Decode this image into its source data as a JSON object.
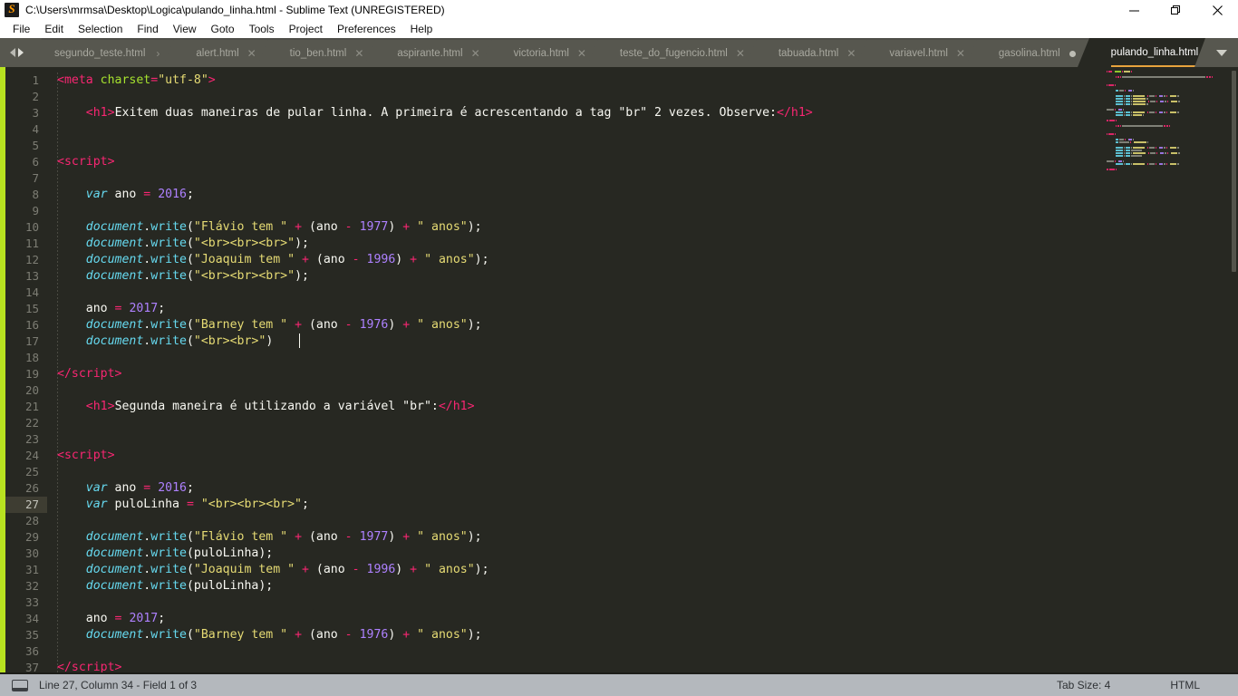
{
  "window": {
    "title": "C:\\Users\\mrmsa\\Desktop\\Logica\\pulando_linha.html - Sublime Text (UNREGISTERED)",
    "logo": "sublime-text-logo",
    "minimize": "—",
    "maximize": "❐",
    "close": "✕"
  },
  "menu": {
    "items": [
      {
        "label": "File"
      },
      {
        "label": "Edit"
      },
      {
        "label": "Selection"
      },
      {
        "label": "Find"
      },
      {
        "label": "View"
      },
      {
        "label": "Goto"
      },
      {
        "label": "Tools"
      },
      {
        "label": "Project"
      },
      {
        "label": "Preferences"
      },
      {
        "label": "Help"
      }
    ]
  },
  "tabs": {
    "overflow_icon": "chevron-down-icon",
    "items": [
      {
        "label": "segundo_teste.html",
        "state": "sep",
        "marker": "›",
        "active": false
      },
      {
        "label": "alert.html",
        "state": "close",
        "marker": "✕",
        "active": false
      },
      {
        "label": "tio_ben.html",
        "state": "close",
        "marker": "✕",
        "active": false
      },
      {
        "label": "aspirante.html",
        "state": "close",
        "marker": "✕",
        "active": false
      },
      {
        "label": "victoria.html",
        "state": "close",
        "marker": "✕",
        "active": false
      },
      {
        "label": "teste_do_fugencio.html",
        "state": "close",
        "marker": "✕",
        "active": false
      },
      {
        "label": "tabuada.html",
        "state": "close",
        "marker": "✕",
        "active": false
      },
      {
        "label": "variavel.html",
        "state": "close",
        "marker": "✕",
        "active": false
      },
      {
        "label": "gasolina.html",
        "state": "dirty",
        "marker": "●",
        "active": false
      },
      {
        "label": "pulando_linha.html",
        "state": "close",
        "marker": "✕",
        "active": true
      }
    ]
  },
  "editor": {
    "accent_color": "#e8a33d",
    "left_stripe_color": "#b8e220",
    "background": "#272822",
    "current_line": 27,
    "first_line": 1,
    "last_line": 37,
    "lines": [
      {
        "n": 1,
        "tokens": [
          {
            "t": "<",
            "c": "tg"
          },
          {
            "t": "meta",
            "c": "tg"
          },
          {
            "t": " ",
            "c": "pl"
          },
          {
            "t": "charset",
            "c": "at"
          },
          {
            "t": "=",
            "c": "tg"
          },
          {
            "t": "\"utf-8\"",
            "c": "st"
          },
          {
            "t": ">",
            "c": "tg"
          }
        ]
      },
      {
        "n": 2,
        "tokens": []
      },
      {
        "n": 3,
        "tokens": [
          {
            "t": "    ",
            "c": "pl"
          },
          {
            "t": "<",
            "c": "tg"
          },
          {
            "t": "h1",
            "c": "tg"
          },
          {
            "t": ">",
            "c": "tg"
          },
          {
            "t": "Exitem duas maneiras de pular linha. A primeira é acrescentando a tag \"br\" 2 vezes. Observe:",
            "c": "pl"
          },
          {
            "t": "</",
            "c": "tg"
          },
          {
            "t": "h1",
            "c": "tg"
          },
          {
            "t": ">",
            "c": "tg"
          }
        ]
      },
      {
        "n": 4,
        "tokens": []
      },
      {
        "n": 5,
        "tokens": []
      },
      {
        "n": 6,
        "tokens": [
          {
            "t": "<",
            "c": "tg"
          },
          {
            "t": "script",
            "c": "tg"
          },
          {
            "t": ">",
            "c": "tg"
          }
        ]
      },
      {
        "n": 7,
        "tokens": []
      },
      {
        "n": 8,
        "tokens": [
          {
            "t": "    ",
            "c": "pl"
          },
          {
            "t": "var",
            "c": "kw"
          },
          {
            "t": " ano ",
            "c": "pl"
          },
          {
            "t": "=",
            "c": "tg"
          },
          {
            "t": " ",
            "c": "pl"
          },
          {
            "t": "2016",
            "c": "nu"
          },
          {
            "t": ";",
            "c": "pn"
          }
        ]
      },
      {
        "n": 9,
        "tokens": []
      },
      {
        "n": 10,
        "tokens": [
          {
            "t": "    ",
            "c": "pl"
          },
          {
            "t": "document",
            "c": "kw"
          },
          {
            "t": ".",
            "c": "pn"
          },
          {
            "t": "write",
            "c": "fn"
          },
          {
            "t": "(",
            "c": "pn"
          },
          {
            "t": "\"Flávio tem \"",
            "c": "st"
          },
          {
            "t": " ",
            "c": "pl"
          },
          {
            "t": "+",
            "c": "tg"
          },
          {
            "t": " (ano ",
            "c": "pl"
          },
          {
            "t": "-",
            "c": "tg"
          },
          {
            "t": " ",
            "c": "pl"
          },
          {
            "t": "1977",
            "c": "nu"
          },
          {
            "t": ") ",
            "c": "pl"
          },
          {
            "t": "+",
            "c": "tg"
          },
          {
            "t": " ",
            "c": "pl"
          },
          {
            "t": "\" anos\"",
            "c": "st"
          },
          {
            "t": ");",
            "c": "pn"
          }
        ]
      },
      {
        "n": 11,
        "tokens": [
          {
            "t": "    ",
            "c": "pl"
          },
          {
            "t": "document",
            "c": "kw"
          },
          {
            "t": ".",
            "c": "pn"
          },
          {
            "t": "write",
            "c": "fn"
          },
          {
            "t": "(",
            "c": "pn"
          },
          {
            "t": "\"<br><br><br>\"",
            "c": "st"
          },
          {
            "t": ");",
            "c": "pn"
          }
        ]
      },
      {
        "n": 12,
        "tokens": [
          {
            "t": "    ",
            "c": "pl"
          },
          {
            "t": "document",
            "c": "kw"
          },
          {
            "t": ".",
            "c": "pn"
          },
          {
            "t": "write",
            "c": "fn"
          },
          {
            "t": "(",
            "c": "pn"
          },
          {
            "t": "\"Joaquim tem \"",
            "c": "st"
          },
          {
            "t": " ",
            "c": "pl"
          },
          {
            "t": "+",
            "c": "tg"
          },
          {
            "t": " (ano ",
            "c": "pl"
          },
          {
            "t": "-",
            "c": "tg"
          },
          {
            "t": " ",
            "c": "pl"
          },
          {
            "t": "1996",
            "c": "nu"
          },
          {
            "t": ") ",
            "c": "pl"
          },
          {
            "t": "+",
            "c": "tg"
          },
          {
            "t": " ",
            "c": "pl"
          },
          {
            "t": "\" anos\"",
            "c": "st"
          },
          {
            "t": ");",
            "c": "pn"
          }
        ]
      },
      {
        "n": 13,
        "tokens": [
          {
            "t": "    ",
            "c": "pl"
          },
          {
            "t": "document",
            "c": "kw"
          },
          {
            "t": ".",
            "c": "pn"
          },
          {
            "t": "write",
            "c": "fn"
          },
          {
            "t": "(",
            "c": "pn"
          },
          {
            "t": "\"<br><br><br>\"",
            "c": "st"
          },
          {
            "t": ");",
            "c": "pn"
          }
        ]
      },
      {
        "n": 14,
        "tokens": []
      },
      {
        "n": 15,
        "tokens": [
          {
            "t": "    ano ",
            "c": "pl"
          },
          {
            "t": "=",
            "c": "tg"
          },
          {
            "t": " ",
            "c": "pl"
          },
          {
            "t": "2017",
            "c": "nu"
          },
          {
            "t": ";",
            "c": "pn"
          }
        ]
      },
      {
        "n": 16,
        "tokens": [
          {
            "t": "    ",
            "c": "pl"
          },
          {
            "t": "document",
            "c": "kw"
          },
          {
            "t": ".",
            "c": "pn"
          },
          {
            "t": "write",
            "c": "fn"
          },
          {
            "t": "(",
            "c": "pn"
          },
          {
            "t": "\"Barney tem \"",
            "c": "st"
          },
          {
            "t": " ",
            "c": "pl"
          },
          {
            "t": "+",
            "c": "tg"
          },
          {
            "t": " (ano ",
            "c": "pl"
          },
          {
            "t": "-",
            "c": "tg"
          },
          {
            "t": " ",
            "c": "pl"
          },
          {
            "t": "1976",
            "c": "nu"
          },
          {
            "t": ") ",
            "c": "pl"
          },
          {
            "t": "+",
            "c": "tg"
          },
          {
            "t": " ",
            "c": "pl"
          },
          {
            "t": "\" anos\"",
            "c": "st"
          },
          {
            "t": ");",
            "c": "pn"
          }
        ]
      },
      {
        "n": 17,
        "tokens": [
          {
            "t": "    ",
            "c": "pl"
          },
          {
            "t": "document",
            "c": "kw"
          },
          {
            "t": ".",
            "c": "pn"
          },
          {
            "t": "write",
            "c": "fn"
          },
          {
            "t": "(",
            "c": "pn"
          },
          {
            "t": "\"<br><br>\"",
            "c": "st"
          },
          {
            "t": ")",
            "c": "pn"
          }
        ]
      },
      {
        "n": 18,
        "tokens": []
      },
      {
        "n": 19,
        "tokens": [
          {
            "t": "</",
            "c": "tg"
          },
          {
            "t": "script",
            "c": "tg"
          },
          {
            "t": ">",
            "c": "tg"
          }
        ]
      },
      {
        "n": 20,
        "tokens": []
      },
      {
        "n": 21,
        "tokens": [
          {
            "t": "    ",
            "c": "pl"
          },
          {
            "t": "<",
            "c": "tg"
          },
          {
            "t": "h1",
            "c": "tg"
          },
          {
            "t": ">",
            "c": "tg"
          },
          {
            "t": "Segunda maneira é utilizando a variável \"br\":",
            "c": "pl"
          },
          {
            "t": "</",
            "c": "tg"
          },
          {
            "t": "h1",
            "c": "tg"
          },
          {
            "t": ">",
            "c": "tg"
          }
        ]
      },
      {
        "n": 22,
        "tokens": []
      },
      {
        "n": 23,
        "tokens": []
      },
      {
        "n": 24,
        "tokens": [
          {
            "t": "<",
            "c": "tg"
          },
          {
            "t": "script",
            "c": "tg"
          },
          {
            "t": ">",
            "c": "tg"
          }
        ]
      },
      {
        "n": 25,
        "tokens": []
      },
      {
        "n": 26,
        "tokens": [
          {
            "t": "    ",
            "c": "pl"
          },
          {
            "t": "var",
            "c": "kw"
          },
          {
            "t": " ano ",
            "c": "pl"
          },
          {
            "t": "=",
            "c": "tg"
          },
          {
            "t": " ",
            "c": "pl"
          },
          {
            "t": "2016",
            "c": "nu"
          },
          {
            "t": ";",
            "c": "pn"
          }
        ]
      },
      {
        "n": 27,
        "tokens": [
          {
            "t": "    ",
            "c": "pl"
          },
          {
            "t": "var",
            "c": "kw"
          },
          {
            "t": " puloLinha ",
            "c": "pl"
          },
          {
            "t": "=",
            "c": "tg"
          },
          {
            "t": " ",
            "c": "pl"
          },
          {
            "t": "\"<br><br><br>\"",
            "c": "st"
          },
          {
            "t": ";",
            "c": "pn"
          }
        ]
      },
      {
        "n": 28,
        "tokens": []
      },
      {
        "n": 29,
        "tokens": [
          {
            "t": "    ",
            "c": "pl"
          },
          {
            "t": "document",
            "c": "kw"
          },
          {
            "t": ".",
            "c": "pn"
          },
          {
            "t": "write",
            "c": "fn"
          },
          {
            "t": "(",
            "c": "pn"
          },
          {
            "t": "\"Flávio tem \"",
            "c": "st"
          },
          {
            "t": " ",
            "c": "pl"
          },
          {
            "t": "+",
            "c": "tg"
          },
          {
            "t": " (ano ",
            "c": "pl"
          },
          {
            "t": "-",
            "c": "tg"
          },
          {
            "t": " ",
            "c": "pl"
          },
          {
            "t": "1977",
            "c": "nu"
          },
          {
            "t": ") ",
            "c": "pl"
          },
          {
            "t": "+",
            "c": "tg"
          },
          {
            "t": " ",
            "c": "pl"
          },
          {
            "t": "\" anos\"",
            "c": "st"
          },
          {
            "t": ");",
            "c": "pn"
          }
        ]
      },
      {
        "n": 30,
        "tokens": [
          {
            "t": "    ",
            "c": "pl"
          },
          {
            "t": "document",
            "c": "kw"
          },
          {
            "t": ".",
            "c": "pn"
          },
          {
            "t": "write",
            "c": "fn"
          },
          {
            "t": "(puloLinha);",
            "c": "pl"
          }
        ]
      },
      {
        "n": 31,
        "tokens": [
          {
            "t": "    ",
            "c": "pl"
          },
          {
            "t": "document",
            "c": "kw"
          },
          {
            "t": ".",
            "c": "pn"
          },
          {
            "t": "write",
            "c": "fn"
          },
          {
            "t": "(",
            "c": "pn"
          },
          {
            "t": "\"Joaquim tem \"",
            "c": "st"
          },
          {
            "t": " ",
            "c": "pl"
          },
          {
            "t": "+",
            "c": "tg"
          },
          {
            "t": " (ano ",
            "c": "pl"
          },
          {
            "t": "-",
            "c": "tg"
          },
          {
            "t": " ",
            "c": "pl"
          },
          {
            "t": "1996",
            "c": "nu"
          },
          {
            "t": ") ",
            "c": "pl"
          },
          {
            "t": "+",
            "c": "tg"
          },
          {
            "t": " ",
            "c": "pl"
          },
          {
            "t": "\" anos\"",
            "c": "st"
          },
          {
            "t": ");",
            "c": "pn"
          }
        ]
      },
      {
        "n": 32,
        "tokens": [
          {
            "t": "    ",
            "c": "pl"
          },
          {
            "t": "document",
            "c": "kw"
          },
          {
            "t": ".",
            "c": "pn"
          },
          {
            "t": "write",
            "c": "fn"
          },
          {
            "t": "(puloLinha);",
            "c": "pl"
          }
        ]
      },
      {
        "n": 33,
        "tokens": []
      },
      {
        "n": 34,
        "tokens": [
          {
            "t": "    ano ",
            "c": "pl"
          },
          {
            "t": "=",
            "c": "tg"
          },
          {
            "t": " ",
            "c": "pl"
          },
          {
            "t": "2017",
            "c": "nu"
          },
          {
            "t": ";",
            "c": "pn"
          }
        ]
      },
      {
        "n": 35,
        "tokens": [
          {
            "t": "    ",
            "c": "pl"
          },
          {
            "t": "document",
            "c": "kw"
          },
          {
            "t": ".",
            "c": "pn"
          },
          {
            "t": "write",
            "c": "fn"
          },
          {
            "t": "(",
            "c": "pn"
          },
          {
            "t": "\"Barney tem \"",
            "c": "st"
          },
          {
            "t": " ",
            "c": "pl"
          },
          {
            "t": "+",
            "c": "tg"
          },
          {
            "t": " (ano ",
            "c": "pl"
          },
          {
            "t": "-",
            "c": "tg"
          },
          {
            "t": " ",
            "c": "pl"
          },
          {
            "t": "1976",
            "c": "nu"
          },
          {
            "t": ") ",
            "c": "pl"
          },
          {
            "t": "+",
            "c": "tg"
          },
          {
            "t": " ",
            "c": "pl"
          },
          {
            "t": "\" anos\"",
            "c": "st"
          },
          {
            "t": ");",
            "c": "pn"
          }
        ]
      },
      {
        "n": 36,
        "tokens": []
      },
      {
        "n": 37,
        "tokens": [
          {
            "t": "</",
            "c": "tg"
          },
          {
            "t": "script",
            "c": "tg"
          },
          {
            "t": ">",
            "c": "tg"
          }
        ]
      }
    ]
  },
  "status": {
    "icon": "window-icon",
    "position": "Line 27, Column 34 - Field 1 of 3",
    "tab_size": "Tab Size: 4",
    "syntax": "HTML"
  }
}
